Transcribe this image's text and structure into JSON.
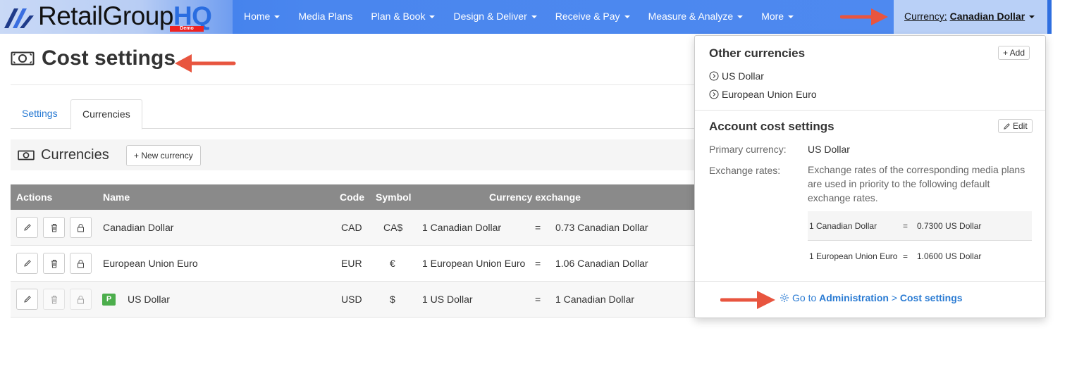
{
  "brand": {
    "name_main": "RetailGroup",
    "name_accent": "HQ",
    "tag": "Demo"
  },
  "nav": {
    "items": [
      {
        "label": "Home",
        "caret": true
      },
      {
        "label": "Media Plans",
        "caret": false
      },
      {
        "label": "Plan & Book",
        "caret": true
      },
      {
        "label": "Design & Deliver",
        "caret": true
      },
      {
        "label": "Receive & Pay",
        "caret": true
      },
      {
        "label": "Measure & Analyze",
        "caret": true
      },
      {
        "label": "More",
        "caret": true
      }
    ],
    "currency_label": "Currency:",
    "currency_value": "Canadian Dollar"
  },
  "page": {
    "title": "Cost settings"
  },
  "tabs": [
    {
      "label": "Settings",
      "active": false
    },
    {
      "label": "Currencies",
      "active": true
    }
  ],
  "section": {
    "title": "Currencies",
    "new_button": "+ New currency"
  },
  "table": {
    "headers": {
      "actions": "Actions",
      "name": "Name",
      "code": "Code",
      "symbol": "Symbol",
      "exchange": "Currency exchange"
    },
    "rows": [
      {
        "name": "Canadian Dollar",
        "code": "CAD",
        "symbol": "CA$",
        "from": "1 Canadian Dollar",
        "eq": "=",
        "to": "0.73 Canadian Dollar",
        "primary": false,
        "delete_disabled": false
      },
      {
        "name": "European Union Euro",
        "code": "EUR",
        "symbol": "€",
        "from": "1 European Union Euro",
        "eq": "=",
        "to": "1.06 Canadian Dollar",
        "primary": false,
        "delete_disabled": false
      },
      {
        "name": "US Dollar",
        "code": "USD",
        "symbol": "$",
        "from": "1 US Dollar",
        "eq": "=",
        "to": "1 Canadian Dollar",
        "primary": true,
        "primary_badge": "P",
        "delete_disabled": true
      }
    ]
  },
  "panel": {
    "other_title": "Other currencies",
    "add_button": "+ Add",
    "other_items": [
      "US Dollar",
      "European Union Euro"
    ],
    "account_title": "Account cost settings",
    "edit_button": "Edit",
    "primary_label": "Primary currency:",
    "primary_value": "US Dollar",
    "rates_label": "Exchange rates:",
    "rates_note": "Exchange rates of the corresponding media plans are used in priority to the following default exchange rates.",
    "rates": [
      {
        "from": "1 Canadian Dollar",
        "eq": "=",
        "to": "0.7300 US Dollar"
      },
      {
        "from": "1 European Union Euro",
        "eq": "=",
        "to": "1.0600 US Dollar"
      }
    ],
    "link_prefix": "Go to",
    "link_admin": "Administration",
    "link_sep": ">",
    "link_cost": "Cost settings"
  },
  "colors": {
    "nav": "#4a86ee",
    "link": "#2a7bd3",
    "arrow": "#e8553f",
    "badge": "#4cae4c",
    "table_head": "#8a8a8a"
  }
}
